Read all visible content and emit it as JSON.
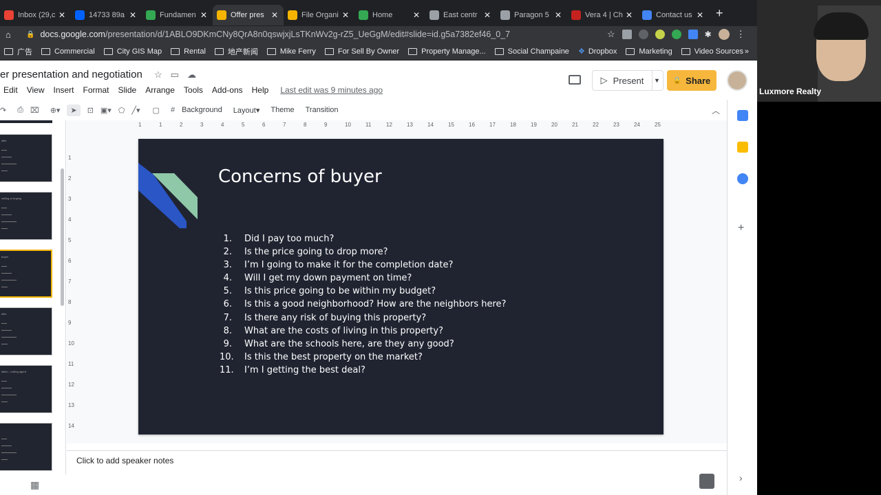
{
  "browser": {
    "tabs": [
      {
        "label": "Inbox (29,c",
        "color": "#ea4335"
      },
      {
        "label": "14733 89a",
        "color": "#0061ff"
      },
      {
        "label": "Fundamen",
        "color": "#34a853"
      },
      {
        "label": "Offer pres",
        "color": "#f4b400",
        "active": true
      },
      {
        "label": "File Organi",
        "color": "#f4b400"
      },
      {
        "label": "Home",
        "color": "#34a853"
      },
      {
        "label": "East centr",
        "color": "#9aa0a6"
      },
      {
        "label": "Paragon 5",
        "color": "#9aa0a6"
      },
      {
        "label": "Vera 4 | Ch",
        "color": "#c5221f"
      },
      {
        "label": "Contact us",
        "color": "#4285f4"
      }
    ],
    "url_host": "docs.google.com",
    "url_path": "/presentation/d/1ABLO9DKmCNy8QrA8n0qswjxjLsTKnWv2g-rZ5_UeGgM/edit#slide=id.g5a7382ef46_0_7",
    "bookmarks": [
      "广告",
      "Commercial",
      "City GIS Map",
      "Rental",
      "地产新闻",
      "Mike Ferry",
      "For Sell By Owner",
      "Property Manage...",
      "Social Champaine",
      "Dropbox",
      "Marketing",
      "Video Sources"
    ]
  },
  "doc": {
    "title": "er presentation and negotiation",
    "menu": [
      "Edit",
      "View",
      "Insert",
      "Format",
      "Slide",
      "Arrange",
      "Tools",
      "Add-ons",
      "Help"
    ],
    "last_edit": "Last edit was 9 minutes ago",
    "present_label": "Present",
    "share_label": "Share"
  },
  "toolbar": {
    "background_label": "Background",
    "layout_label": "Layout",
    "theme_label": "Theme",
    "transition_label": "Transition"
  },
  "ruler": {
    "h": [
      "1",
      "1",
      "2",
      "3",
      "4",
      "5",
      "6",
      "7",
      "8",
      "9",
      "10",
      "11",
      "12",
      "13",
      "14",
      "15",
      "16",
      "17",
      "18",
      "19",
      "20",
      "21",
      "22",
      "23",
      "24",
      "25"
    ],
    "v": [
      "1",
      "2",
      "3",
      "4",
      "5",
      "6",
      "7",
      "8",
      "9",
      "10",
      "11",
      "12",
      "13",
      "14"
    ]
  },
  "slide": {
    "title": "Concerns of buyer",
    "items": [
      "Did I pay too much?",
      "Is the price going to drop more?",
      "I’m I going to make it for the completion date?",
      "Will I get my down payment on time?",
      "Is this price going to be within my budget?",
      "Is this a good neighborhood? How are the neighbors here?",
      "Is there any risk of buying this property?",
      "What are the costs of living in this property?",
      "What are the schools here, are they any good?",
      "Is this the best property on the market?",
      "I’m I getting the best deal?"
    ]
  },
  "thumbnails": [
    {
      "label": "aller"
    },
    {
      "label": "selling or buying"
    },
    {
      "label": "buyer",
      "selected": true
    },
    {
      "label": "eller"
    },
    {
      "label": "iation - Listing agent"
    },
    {
      "label": ""
    }
  ],
  "notes": {
    "placeholder": "Click to add speaker notes"
  },
  "webcam": {
    "name": "Luxmore Realty"
  }
}
